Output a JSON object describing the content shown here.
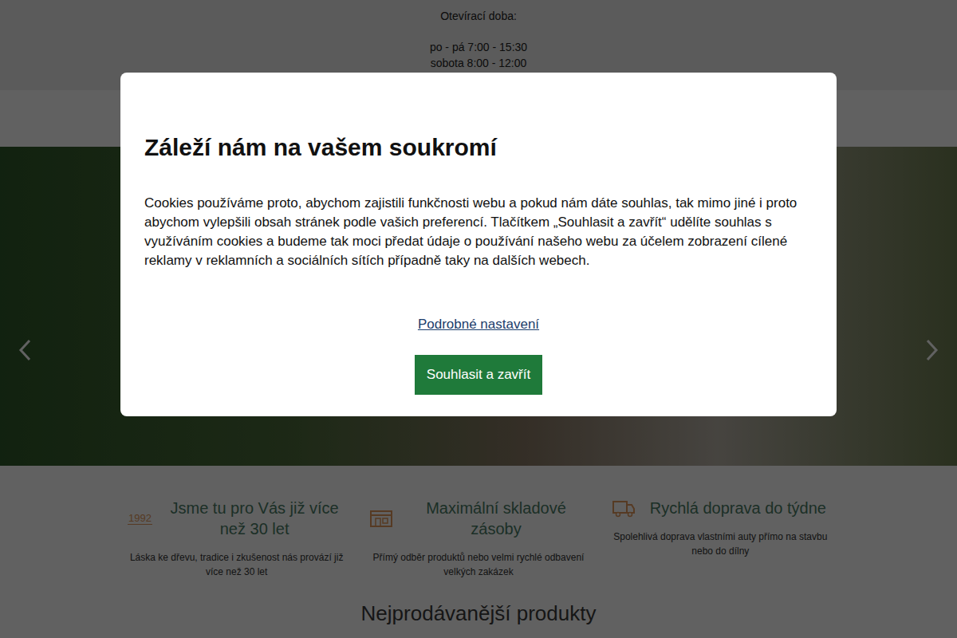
{
  "opening_hours": {
    "title": "Otevírací doba:",
    "lines": [
      "po - pá 7:00 - 15:30",
      "sobota 8:00 - 12:00"
    ]
  },
  "features": [
    {
      "badge": "1992",
      "kind": "year",
      "title": "Jsme tu pro Vás již více než 30 let",
      "text": "Láska ke dřevu, tradice i zkušenost nás provází již více než 30 let"
    },
    {
      "badge": "",
      "kind": "warehouse",
      "title": "Maximální skladové zásoby",
      "text": "Přímý odběr produktů nebo velmi rychlé odbavení velkých zakázek"
    },
    {
      "badge": "",
      "kind": "truck",
      "title": "Rychlá doprava do týdne",
      "text": "Spolehlivá doprava vlastními auty přímo na stavbu nebo do dílny"
    }
  ],
  "section_title": "Nejprodávanější produkty",
  "cookie_dialog": {
    "title": "Záleží nám na vašem soukromí",
    "text": "Cookies používáme proto, abychom zajistili funkčnosti webu a pokud nám dáte souhlas, tak mimo jiné i proto abychom vylepšili obsah stránek podle vašich preferencí. Tlačítkem „Souhlasit a zavřít“ udělíte souhlas s využíváním cookies a budeme tak moci předat údaje o používání našeho webu za účelem zobrazení cílené reklamy v reklamních a sociálních sítích případně taky na dalších webech.",
    "link": "Podrobné nastavení",
    "button": "Souhlasit a zavřít"
  }
}
